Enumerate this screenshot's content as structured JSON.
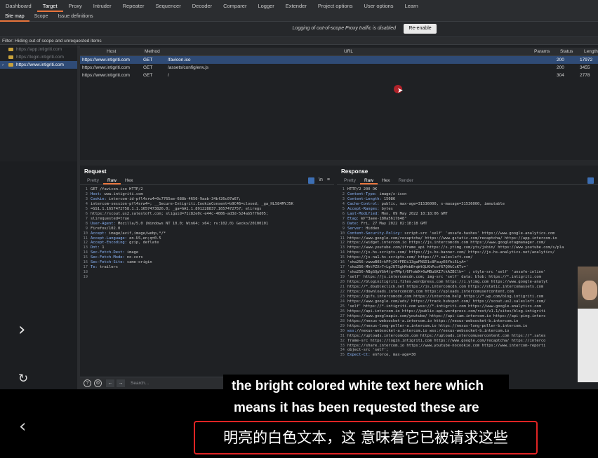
{
  "top_tabs": [
    "Dashboard",
    "Target",
    "Proxy",
    "Intruder",
    "Repeater",
    "Sequencer",
    "Decoder",
    "Comparer",
    "Logger",
    "Extender",
    "Project options",
    "User options",
    "Learn"
  ],
  "sub_tabs": [
    "Site map",
    "Scope",
    "Issue definitions"
  ],
  "notice": {
    "message": "Logging of out-of-scope Proxy traffic is disabled",
    "button": "Re-enable"
  },
  "filter": "Filter: Hiding out of scope and unrequested items",
  "tree": [
    {
      "label": "https://app.intigriti.com"
    },
    {
      "label": "https://login.intigriti.com"
    },
    {
      "label": "https://www.intigriti.com"
    }
  ],
  "table": {
    "headers": {
      "host": "Host",
      "method": "Method",
      "url": "URL",
      "params": "Params",
      "status": "Status",
      "length": "Length"
    },
    "rows": [
      {
        "host": "https://www.intigriti.com",
        "method": "GET",
        "url": "/favicon.ico",
        "status": "200",
        "length": "17972"
      },
      {
        "host": "https://www.intigriti.com",
        "method": "GET",
        "url": "/assets/config/env.js",
        "status": "200",
        "length": "3455"
      },
      {
        "host": "https://www.intigriti.com",
        "method": "GET",
        "url": "/",
        "status": "304",
        "length": "2778"
      }
    ]
  },
  "request": {
    "title": "Request",
    "tabs": [
      "Pretty",
      "Raw",
      "Hex"
    ],
    "newline_label": "\\n",
    "lines": [
      "GET /favicon.ico HTTP/2",
      "Host: www.intigriti.com",
      "Cookie: intercom-id-pfl4srw4=0c7765ae-688b-4656-9aab-34bf26c07a67;",
      "intercom-session-pfl4srw4=; __Secure-Intigriti.CookieConsent=b9C46=closed; _ga_HL584MYJ5K",
      "=GS1.1.1657472758.1.1.1657473826.0; _ga=GA1.1.891228837.1657472757; eliregs",
      "https://scout.us2.salesloft.com; sliguid=71c82e0c-e44c-4086-ad3d-524ab5f76d05;",
      "slirequested=true",
      "User-Agent: Mozilla/5.0 (Windows NT 10.0; Win64; x64; rv:102.0) Gecko/20100101",
      "Firefox/102.0",
      "Accept: image/avif,image/webp,*/*",
      "Accept-Language: en-US,en;q=0.5",
      "Accept-Encoding: gzip, deflate",
      "Dnt: 1",
      "Sec-Fetch-Dest: image",
      "Sec-Fetch-Mode: no-cors",
      "Sec-Fetch-Site: same-origin",
      "Te: trailers",
      "",
      ""
    ]
  },
  "response": {
    "title": "Response",
    "tabs": [
      "Pretty",
      "Raw",
      "Hex",
      "Render"
    ],
    "lines": [
      "HTTP/2 200 OK",
      "Content-Type: image/x-icon",
      "Content-Length: 15086",
      "Cache-Control: public, max-age=31536000, s-maxage=31536000, immutable",
      "Accept-Ranges: bytes",
      "Last-Modified: Mon, 09 May 2022 10:18:06 GMT",
      "Etag: W/\"3aee-180a5617b48\"",
      "Date: Fri, 27 May 2022 02:18:18 GMT",
      "Server: Hidden",
      "Content-Security-Policy: script-src 'self' 'unsafe-hashes' https://www.google-analytics.com",
      "https://www.google.com/recaptcha/ https://www.gstatic.com/recaptcha/ https://app.intercom.io",
      "https://widget.intercom.io https://js.intercomcdn.com https://www.googletagmanager.com/",
      "https://www.youtube.com/iframe_api https://s.ytimg.com/yts/jsbin/ https://www.youtube.com/s/pla",
      "https://js.hs-scripts.com/ https://js.hs-banner.com/ https://js.hs-analytics.net/analytics/",
      "https://js-na1.hs-scripts.com/ https://*.salesloft.com/",
      "'sha256-vwwwB03+kPPj2OfFRDi13gaFNSD1c8FauyE6Yhi5LyA='",
      "'sha256-MhtPZXr7+LgJUTSghMnbB+qWtQLKhPcof67Q0kCcKTc='",
      "'sha256-ABgGQpVGh4/g+FMpf/6FhaWX+6wMBuGKI7tkAZBClk=' ; style-src 'self' 'unsafe-inline'",
      "'self' https://js.intercomcdn.com; img-src 'self' data: blob: https://*.intigriti.com",
      "https://bloginitigriti.files.wordpress.com https://i.ytimg.com https://www.google-analyt",
      "https://*.doubleclick.net https://js.intercomcdn.com https://static.intercomassets.com",
      "https://downloads.intercomcdn.com https://uploads.intercomusercontent.com",
      "https://gifs.intercomcdn.com https://intercom.help https://*.wp.com/blog.intigriti.com",
      "https://www.google.com/ads/ https://track.hubspot.com/ https://scout.us2.salesloft.com/",
      "'self' https://*.intigriti.com wss://*.intigriti.com https://www.google-analytics.com",
      "https://api.intercom.io https://public-api.wordpress.com/rest/v1.1/sites/blog.intigriti",
      "https://www.googleapis.com/youtube/ https://api-iam.intercom.io https://api-ping.interc",
      "https://nexus-websocket-a.intercom.io https://nexus-websocket-b.intercom.io",
      "https://nexus-long-poller-a.intercom.io https://nexus-long-poller-b.intercom.io",
      "wss://nexus-websocket-a.intercom.io wss://nexus-websocket-b.intercom.io",
      "https://uploads.intercomcdn.com https://uploads.intercomusercontent.com https://*.sales",
      "frame-src https://login.intigriti.com https://www.google.com/recaptcha/ https://interco",
      "https://share.intercom.io https://www.youtube-nocookie.com https://www.intercom-reporti",
      "object-src 'self';",
      "Expect-Ct: enforce, max-age=30"
    ]
  },
  "search": {
    "placeholder": "Search..."
  },
  "subtitles": {
    "en_line1": "the bright colored white text here which",
    "en_line2": "means it has been requested these are",
    "cn": "明亮的白色文本，这 意味着它已被请求这些"
  }
}
